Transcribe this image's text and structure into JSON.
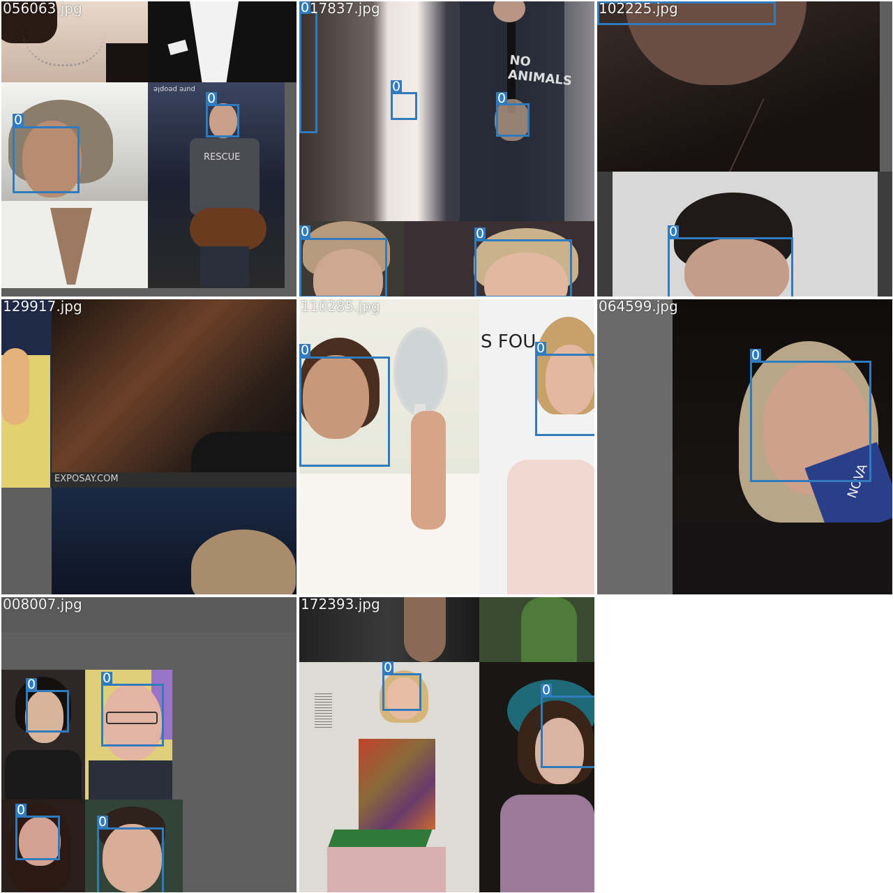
{
  "tiles": [
    {
      "filename": "056063.jpg",
      "detections": [
        "0",
        "0"
      ]
    },
    {
      "filename": "017837.jpg",
      "detections": [
        "0",
        "0",
        "0",
        "0",
        "0"
      ]
    },
    {
      "filename": "102225.jpg",
      "detections": [
        "0"
      ]
    },
    {
      "filename": "129917.jpg",
      "detections": []
    },
    {
      "filename": "110285.jpg",
      "detections": [
        "0",
        "0"
      ]
    },
    {
      "filename": "064599.jpg",
      "detections": [
        "0"
      ]
    },
    {
      "filename": "008007.jpg",
      "detections": [
        "0",
        "0",
        "0",
        "0"
      ]
    },
    {
      "filename": "172393.jpg",
      "detections": [
        "0",
        "0"
      ]
    }
  ],
  "overlay_text": {
    "watermark": "EXPOSAY.COM",
    "shirt": "RESCUE",
    "banner": "S FOU",
    "pack": "NOVA",
    "shirt2": "NO ANIMALS"
  },
  "colors": {
    "box": "#2f7bbd",
    "background": "#5f5f5f"
  }
}
